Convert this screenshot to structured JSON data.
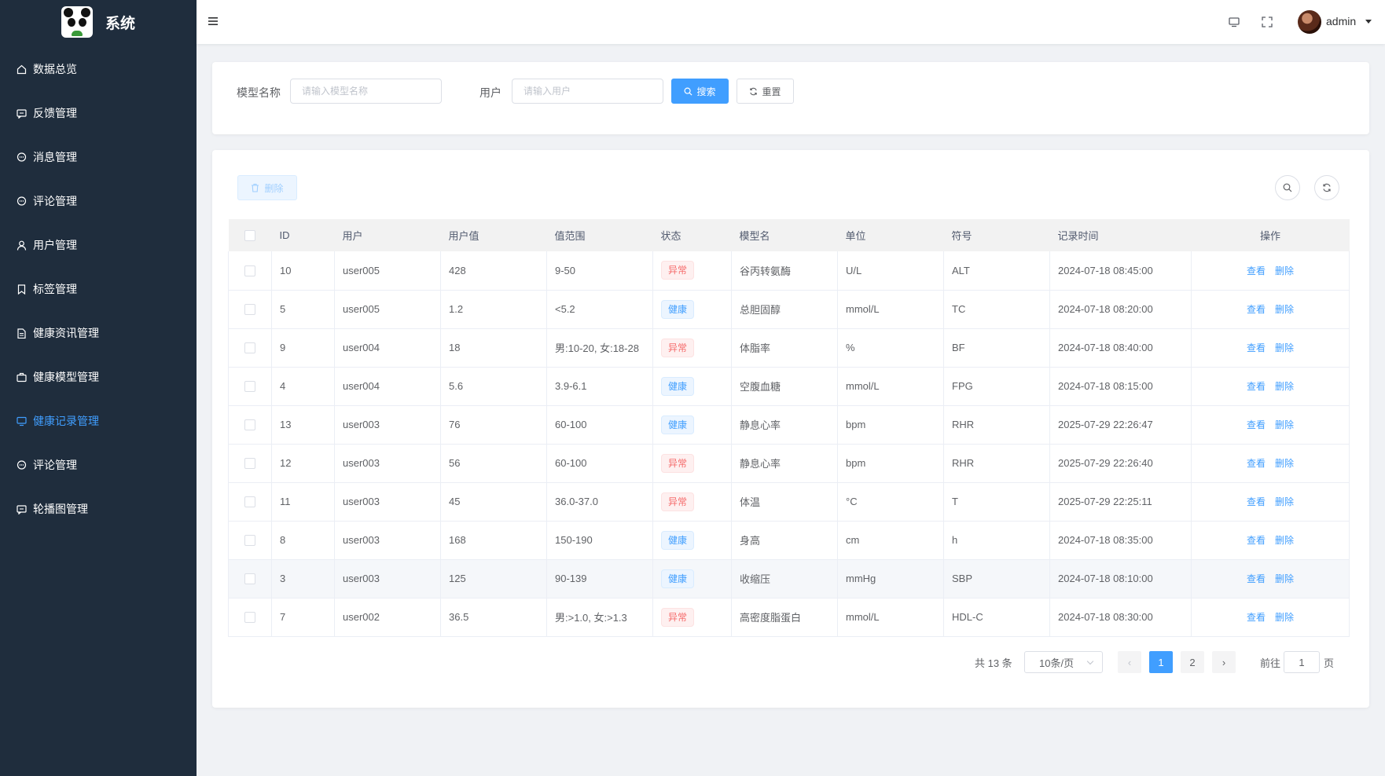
{
  "app": {
    "title": "系统"
  },
  "sidebar": {
    "items": [
      {
        "label": "数据总览",
        "icon": "home-icon",
        "active": false
      },
      {
        "label": "反馈管理",
        "icon": "chat-icon",
        "active": false
      },
      {
        "label": "消息管理",
        "icon": "message-icon",
        "active": false
      },
      {
        "label": "评论管理",
        "icon": "comment-icon",
        "active": false
      },
      {
        "label": "用户管理",
        "icon": "user-icon",
        "active": false
      },
      {
        "label": "标签管理",
        "icon": "bookmark-icon",
        "active": false
      },
      {
        "label": "健康资讯管理",
        "icon": "document-icon",
        "active": false
      },
      {
        "label": "健康模型管理",
        "icon": "box-icon",
        "active": false
      },
      {
        "label": "健康记录管理",
        "icon": "monitor-icon",
        "active": true
      },
      {
        "label": "评论管理",
        "icon": "comment-icon",
        "active": false
      },
      {
        "label": "轮播图管理",
        "icon": "chat-icon",
        "active": false
      }
    ]
  },
  "header": {
    "user_name": "admin"
  },
  "search": {
    "model_label": "模型名称",
    "model_placeholder": "请输入模型名称",
    "user_label": "用户",
    "user_placeholder": "请输入用户",
    "search_button": "搜索",
    "reset_button": "重置"
  },
  "toolbar": {
    "delete_button": "删除"
  },
  "table": {
    "columns": [
      "ID",
      "用户",
      "用户值",
      "值范围",
      "状态",
      "模型名",
      "单位",
      "符号",
      "记录时间",
      "操作"
    ],
    "rows": [
      {
        "id": "10",
        "user": "user005",
        "value": "428",
        "range": "9-50",
        "status": "异常",
        "status_type": "bad",
        "model": "谷丙转氨酶",
        "unit": "U/L",
        "symbol": "ALT",
        "time": "2024-07-18 08:45:00"
      },
      {
        "id": "5",
        "user": "user005",
        "value": "1.2",
        "range": "<5.2",
        "status": "健康",
        "status_type": "ok",
        "model": "总胆固醇",
        "unit": "mmol/L",
        "symbol": "TC",
        "time": "2024-07-18 08:20:00"
      },
      {
        "id": "9",
        "user": "user004",
        "value": "18",
        "range": "男:10-20, 女:18-28",
        "status": "异常",
        "status_type": "bad",
        "model": "体脂率",
        "unit": "%",
        "symbol": "BF",
        "time": "2024-07-18 08:40:00"
      },
      {
        "id": "4",
        "user": "user004",
        "value": "5.6",
        "range": "3.9-6.1",
        "status": "健康",
        "status_type": "ok",
        "model": "空腹血糖",
        "unit": "mmol/L",
        "symbol": "FPG",
        "time": "2024-07-18 08:15:00"
      },
      {
        "id": "13",
        "user": "user003",
        "value": "76",
        "range": "60-100",
        "status": "健康",
        "status_type": "ok",
        "model": "静息心率",
        "unit": "bpm",
        "symbol": "RHR",
        "time": "2025-07-29 22:26:47"
      },
      {
        "id": "12",
        "user": "user003",
        "value": "56",
        "range": "60-100",
        "status": "异常",
        "status_type": "bad",
        "model": "静息心率",
        "unit": "bpm",
        "symbol": "RHR",
        "time": "2025-07-29 22:26:40"
      },
      {
        "id": "11",
        "user": "user003",
        "value": "45",
        "range": "36.0-37.0",
        "status": "异常",
        "status_type": "bad",
        "model": "体温",
        "unit": "°C",
        "symbol": "T",
        "time": "2025-07-29 22:25:11"
      },
      {
        "id": "8",
        "user": "user003",
        "value": "168",
        "range": "150-190",
        "status": "健康",
        "status_type": "ok",
        "model": "身高",
        "unit": "cm",
        "symbol": "h",
        "time": "2024-07-18 08:35:00"
      },
      {
        "id": "3",
        "user": "user003",
        "value": "125",
        "range": "90-139",
        "status": "健康",
        "status_type": "ok",
        "model": "收缩压",
        "unit": "mmHg",
        "symbol": "SBP",
        "time": "2024-07-18 08:10:00"
      },
      {
        "id": "7",
        "user": "user002",
        "value": "36.5",
        "range": "男:>1.0, 女:>1.3",
        "status": "异常",
        "status_type": "bad",
        "model": "高密度脂蛋白",
        "unit": "mmol/L",
        "symbol": "HDL-C",
        "time": "2024-07-18 08:30:00"
      }
    ],
    "view_label": "查看",
    "delete_label": "删除"
  },
  "pagination": {
    "total_text": "共 13 条",
    "page_size": "10条/页",
    "pages": [
      "1",
      "2"
    ],
    "current": "1",
    "goto_label": "前往",
    "goto_value": "1",
    "page_suffix": "页"
  },
  "colors": {
    "sidebar_bg": "#1f2d3d",
    "primary": "#409eff",
    "danger": "#f56c6c"
  }
}
